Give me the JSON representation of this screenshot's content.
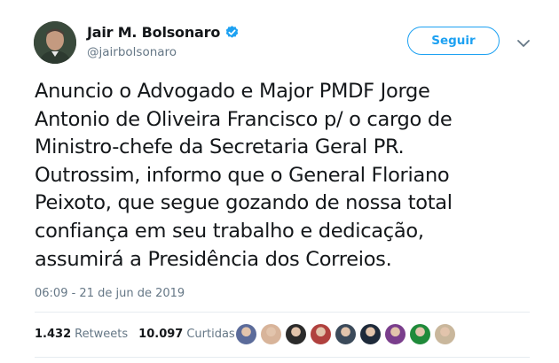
{
  "author": {
    "display_name": "Jair M. Bolsonaro",
    "handle": "@jairbolsonaro",
    "verified": true
  },
  "follow_button": {
    "label": "Seguir"
  },
  "tweet": {
    "lines": [
      "Anuncio o Advogado e Major PMDF Jorge",
      "Antonio de Oliveira Francisco p/ o cargo de",
      "Ministro-chefe da Secretaria Geral PR.",
      "Outrossim, informo que o General Floriano",
      "Peixoto, que segue gozando de nossa total",
      "confiança em seu trabalho e dedicação,",
      "assumirá a Presidência dos Correios."
    ],
    "timestamp": "06:09 - 21 de jun de 2019"
  },
  "stats": {
    "retweets_count": "1.432",
    "retweets_label": "Retweets",
    "likes_count": "10.097",
    "likes_label": "Curtidas"
  },
  "liker_avatars": [
    {
      "name": "liker-avatar-1",
      "color": "#5b6b9a"
    },
    {
      "name": "liker-avatar-2",
      "color": "#d8b49a"
    },
    {
      "name": "liker-avatar-3",
      "color": "#2b2b2b"
    },
    {
      "name": "liker-avatar-4",
      "color": "#b0413e"
    },
    {
      "name": "liker-avatar-5",
      "color": "#3b4a5a"
    },
    {
      "name": "liker-avatar-6",
      "color": "#1e2a3a"
    },
    {
      "name": "liker-avatar-7",
      "color": "#7a3e8c"
    },
    {
      "name": "liker-avatar-8",
      "color": "#1f8a3a"
    },
    {
      "name": "liker-avatar-9",
      "color": "#c9b79c"
    }
  ],
  "colors": {
    "accent": "#1da1f2",
    "text_primary": "#14171a",
    "text_secondary": "#657786",
    "divider": "#e6ecf0"
  }
}
